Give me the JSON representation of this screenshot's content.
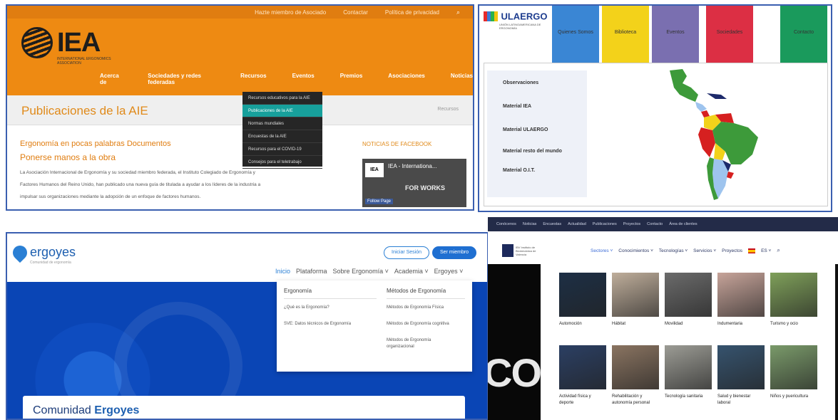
{
  "iea": {
    "top_links": [
      "Hazte miembro de Asociado",
      "Contactar",
      "Política de privacidad"
    ],
    "logo_text": "IEA",
    "logo_sub": "INTERNATIONAL ERGONOMICS ASSOCIATION",
    "nav": [
      "Acerca de",
      "Sociedades y redes federadas",
      "Recursos",
      "Eventos",
      "Premios",
      "Asociaciones",
      "Noticias"
    ],
    "page_title": "Publicaciones de la AIE",
    "breadcrumb": "Recursos",
    "dropdown": [
      "Recursos educativos para la AIE",
      "Publicaciones de la AIE",
      "Normas mundiales",
      "Encuestas de la AIE",
      "Recursos para el COVID-19",
      "Consejos para el teletrabajo"
    ],
    "heading1": "Ergonomía en pocas palabras Documentos",
    "heading2": "Ponerse manos a la obra",
    "body": [
      "La Asociación Internacional de Ergonomía y su sociedad miembro federada, el Instituto Colegiado de Ergonomía y",
      "Factores Humanos del Reino Unido, han publicado una nueva guía de titulada a ayudar a los líderes de la industria a",
      "impulsar sus organizaciones mediante la adopción de un enfoque de factores humanos."
    ],
    "fb_heading": "NOTICIAS DE FACEBOOK",
    "fb_logo": "IEA",
    "fb_title": "IEA - Internationa...",
    "fb_banner": "FOR WORKS",
    "fb_follow": "Follow Page"
  },
  "ulaergo": {
    "logo_text": "ULAERGO",
    "logo_sub": "UNIÓN LATINOAMERICANA DE ERGONOMÍA",
    "tabs": [
      {
        "label": "Quienes Somos",
        "color": "#3a86d4"
      },
      {
        "label": "Biblioteca",
        "color": "#f3d21a"
      },
      {
        "label": "Eventos",
        "color": "#7a6fb0"
      },
      {
        "label": "Sociedades",
        "color": "#dc2f44"
      },
      {
        "label": "Contacto",
        "color": "#1a9a5c"
      }
    ],
    "side_items": [
      "Observaciones",
      "Material IEA",
      "Material ULAERGO",
      "Material resto del mundo",
      "Material O.I.T."
    ],
    "map_colors": {
      "green": "#3d9a3a",
      "red": "#d62020",
      "yellow": "#f2d21a",
      "lightblue": "#9ec4ee",
      "navy": "#1d2a6b"
    }
  },
  "ergoyes": {
    "logo_text": "ergoyes",
    "logo_sub": "Comunidad de ergonomía",
    "btn_login": "Iniciar Sesión",
    "btn_register": "Ser miembro",
    "nav": [
      {
        "label": "Inicio",
        "active": true
      },
      {
        "label": "Plataforma",
        "active": false
      },
      {
        "label": "Sobre Ergonomía ˅",
        "active": false
      },
      {
        "label": "Academia ˅",
        "active": false
      },
      {
        "label": "Ergoyes ˅",
        "active": false
      }
    ],
    "mega_col1_title": "Ergonomía",
    "mega_col1": [
      "¿Qué es la Ergonomía?",
      "SVE: Datos técnicos de Ergonomía"
    ],
    "mega_col2_title": "Métodos de Ergonomía",
    "mega_col2": [
      "Métodos de Ergonomía Física",
      "Métodos de Ergonomía cognitiva",
      "Métodos de Ergonomía organizacional"
    ],
    "card_prefix": "Comunidad",
    "card_brand": "Ergoyes",
    "brand_blue": "#0e4cbf"
  },
  "portal": {
    "top_links": [
      "Conócenos",
      "Noticias",
      "Encuestas",
      "Actualidad",
      "Publicaciones",
      "Proyectos",
      "Contacto",
      "Área de clientes"
    ],
    "logo_text": "IBV Instituto de Biomecánica de Valencia",
    "nav": [
      {
        "label": "Sectores ˅",
        "active": true
      },
      {
        "label": "Conocimientos ˅",
        "active": false
      },
      {
        "label": "Tecnologías ˅",
        "active": false
      },
      {
        "label": "Servicios ˅",
        "active": false
      },
      {
        "label": "Proyectos",
        "active": false
      }
    ],
    "lang": "ES ˅",
    "big_text": "CO",
    "tiles": [
      {
        "label": "Automoción",
        "color": "#1d2f45"
      },
      {
        "label": "Hábitat",
        "color": "#bfae9b"
      },
      {
        "label": "Movilidad",
        "color": "#6b6b6b"
      },
      {
        "label": "Indumentaria",
        "color": "#c7a49a"
      },
      {
        "label": "Turismo y ocio",
        "color": "#7fa05a"
      },
      {
        "label": "Actividad física y deporte",
        "color": "#2b3f63"
      },
      {
        "label": "Rehabilitación y autonomía personal",
        "color": "#8a7461"
      },
      {
        "label": "Tecnología sanitaria",
        "color": "#9c9c95"
      },
      {
        "label": "Salud y bienestar laboral",
        "color": "#36536e"
      },
      {
        "label": "Niños y puericultura",
        "color": "#7a9a6a"
      }
    ]
  }
}
